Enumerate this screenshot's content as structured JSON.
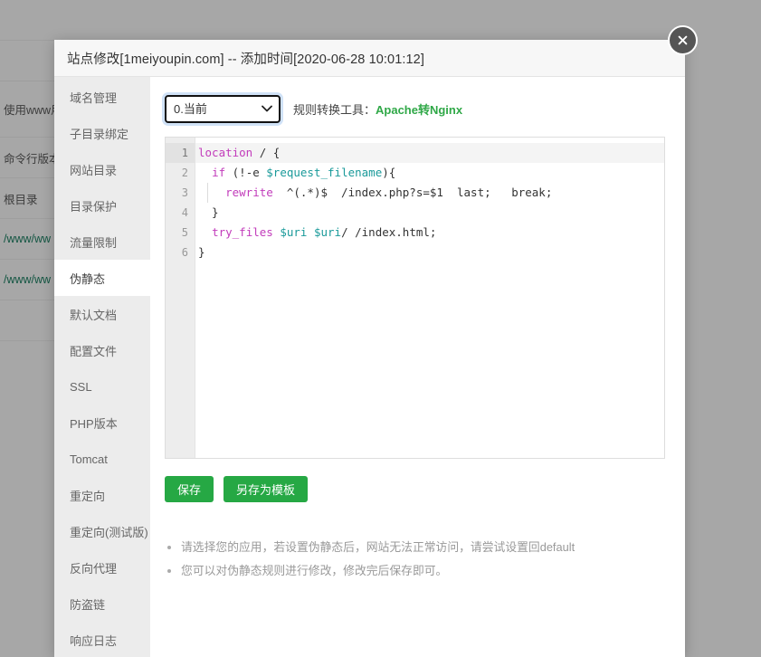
{
  "background": {
    "rows": [
      {
        "text": "",
        "style": "empty"
      },
      {
        "text": "",
        "style": "empty"
      },
      {
        "text": "使用www用",
        "style": "plain"
      },
      {
        "text": "命令行版本",
        "style": "plain"
      },
      {
        "text": "根目录",
        "style": "plain"
      },
      {
        "text": "/www/ww",
        "style": "green"
      },
      {
        "text": "/www/ww",
        "style": "green"
      },
      {
        "text": "",
        "style": "empty"
      }
    ]
  },
  "modal": {
    "title": "站点修改[1meiyoupin.com] -- 添加时间[2020-06-28 10:01:12]",
    "close_icon": "close-circle-icon"
  },
  "sidebar": {
    "items": [
      {
        "label": "域名管理",
        "active": false
      },
      {
        "label": "子目录绑定",
        "active": false
      },
      {
        "label": "网站目录",
        "active": false
      },
      {
        "label": "目录保护",
        "active": false
      },
      {
        "label": "流量限制",
        "active": false
      },
      {
        "label": "伪静态",
        "active": true
      },
      {
        "label": "默认文档",
        "active": false
      },
      {
        "label": "配置文件",
        "active": false
      },
      {
        "label": "SSL",
        "active": false
      },
      {
        "label": "PHP版本",
        "active": false
      },
      {
        "label": "Tomcat",
        "active": false
      },
      {
        "label": "重定向",
        "active": false
      },
      {
        "label": "重定向(测试版)",
        "active": false
      },
      {
        "label": "反向代理",
        "active": false
      },
      {
        "label": "防盗链",
        "active": false
      },
      {
        "label": "响应日志",
        "active": false
      }
    ]
  },
  "toolbar": {
    "select_value": "0.当前",
    "select_options": [
      "0.当前"
    ],
    "chevron_icon": "chevron-down-icon",
    "converter_label": "规则转换工具：",
    "converter_link": "Apache转Nginx"
  },
  "editor": {
    "line_numbers": [
      "1",
      "2",
      "3",
      "4",
      "5",
      "6"
    ],
    "lines": [
      {
        "n": 1,
        "current": true,
        "tokens": [
          {
            "t": "location",
            "c": "kw"
          },
          {
            "t": " / {",
            "c": "plain"
          }
        ]
      },
      {
        "n": 2,
        "current": false,
        "tokens": [
          {
            "t": "  ",
            "c": "plain"
          },
          {
            "t": "if",
            "c": "kw"
          },
          {
            "t": " (!-e ",
            "c": "plain"
          },
          {
            "t": "$request_filename",
            "c": "var"
          },
          {
            "t": "){",
            "c": "plain"
          }
        ]
      },
      {
        "n": 3,
        "current": false,
        "tokens": [
          {
            "t": "    ",
            "c": "plain"
          },
          {
            "t": "rewrite",
            "c": "kw"
          },
          {
            "t": "  ^(.*)$  /index.php?s=$1  last;   break;",
            "c": "plain"
          }
        ]
      },
      {
        "n": 4,
        "current": false,
        "tokens": [
          {
            "t": "  }",
            "c": "plain"
          }
        ]
      },
      {
        "n": 5,
        "current": false,
        "tokens": [
          {
            "t": "  ",
            "c": "plain"
          },
          {
            "t": "try_files",
            "c": "kw"
          },
          {
            "t": " ",
            "c": "plain"
          },
          {
            "t": "$uri",
            "c": "var"
          },
          {
            "t": " ",
            "c": "plain"
          },
          {
            "t": "$uri",
            "c": "var"
          },
          {
            "t": "/ /index.html;",
            "c": "plain"
          }
        ]
      },
      {
        "n": 6,
        "current": false,
        "tokens": [
          {
            "t": "}",
            "c": "plain"
          }
        ]
      }
    ]
  },
  "buttons": {
    "save": "保存",
    "save_as_template": "另存为模板"
  },
  "notes": [
    "请选择您的应用，若设置伪静态后，网站无法正常访问，请尝试设置回default",
    "您可以对伪静态规则进行修改，修改完后保存即可。"
  ],
  "colors": {
    "accent_green": "#26a844",
    "link_green": "#2fa847",
    "keyword": "#c23cbb",
    "variable": "#1a9a9a",
    "sidebar_bg": "#ececec"
  }
}
